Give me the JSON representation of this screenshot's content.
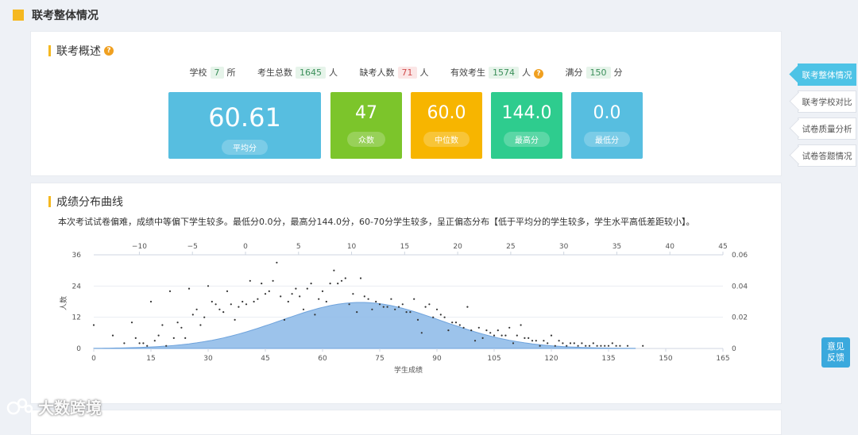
{
  "page_title": "联考整体情况",
  "overview": {
    "title": "联考概述",
    "stats": [
      {
        "label": "学校",
        "value": "7",
        "unit": "所",
        "tone": "g"
      },
      {
        "label": "考生总数",
        "value": "1645",
        "unit": "人",
        "tone": "g"
      },
      {
        "label": "缺考人数",
        "value": "71",
        "unit": "人",
        "tone": "r"
      },
      {
        "label": "有效考生",
        "value": "1574",
        "unit": "人",
        "tone": "g"
      },
      {
        "label": "满分",
        "value": "150",
        "unit": "分",
        "tone": "g"
      }
    ],
    "tiles": [
      {
        "value": "60.61",
        "label": "平均分",
        "color": "#57bee0"
      },
      {
        "value": "47",
        "label": "众数",
        "color": "#7cc52b"
      },
      {
        "value": "60.0",
        "label": "中位数",
        "color": "#f7b500"
      },
      {
        "value": "144.0",
        "label": "最高分",
        "color": "#2ecc8e"
      },
      {
        "value": "0.0",
        "label": "最低分",
        "color": "#57bee0"
      }
    ]
  },
  "distribution": {
    "title": "成绩分布曲线",
    "description": "本次考试试卷偏难，成绩中等偏下学生较多。最低分0.0分，最高分144.0分，60-70分学生较多，呈正偏态分布【低于平均分的学生较多，学生水平高低差距较小】。"
  },
  "chart_data": {
    "type": "scatter",
    "xlabel": "学生成绩",
    "ylabel": "人数",
    "xlim": [
      0,
      165
    ],
    "ylim": [
      0,
      36
    ],
    "x_ticks": [
      0,
      15,
      30,
      45,
      60,
      75,
      90,
      105,
      120,
      135,
      150,
      165
    ],
    "y_ticks": [
      0,
      12,
      24,
      36
    ],
    "top_axis": {
      "lim": [
        -14.3,
        45
      ],
      "ticks": [
        -10,
        -5,
        0,
        5,
        10,
        15,
        20,
        25,
        30,
        35,
        40,
        45
      ]
    },
    "right_axis": {
      "lim": [
        0,
        0.06
      ],
      "ticks": [
        "0",
        "0.02",
        "0.04",
        "0.06"
      ]
    },
    "curve": {
      "mean": 70,
      "sd": 21,
      "peak_density": 0.0295,
      "range": [
        0,
        142
      ],
      "color": "#8bb8e8"
    },
    "points": [
      [
        0,
        9
      ],
      [
        5,
        5
      ],
      [
        8,
        2
      ],
      [
        10,
        10
      ],
      [
        11,
        4
      ],
      [
        12,
        2
      ],
      [
        13,
        2
      ],
      [
        14,
        1
      ],
      [
        15,
        18
      ],
      [
        16,
        3
      ],
      [
        17,
        5
      ],
      [
        18,
        9
      ],
      [
        19,
        1
      ],
      [
        20,
        22
      ],
      [
        21,
        4
      ],
      [
        22,
        10
      ],
      [
        23,
        8
      ],
      [
        24,
        4
      ],
      [
        25,
        23
      ],
      [
        26,
        13
      ],
      [
        27,
        15
      ],
      [
        28,
        9
      ],
      [
        29,
        12
      ],
      [
        30,
        24
      ],
      [
        31,
        18
      ],
      [
        32,
        17
      ],
      [
        33,
        15
      ],
      [
        34,
        14
      ],
      [
        35,
        22
      ],
      [
        36,
        17
      ],
      [
        37,
        11
      ],
      [
        38,
        16
      ],
      [
        39,
        18
      ],
      [
        40,
        17
      ],
      [
        41,
        26
      ],
      [
        42,
        18
      ],
      [
        43,
        19
      ],
      [
        44,
        25
      ],
      [
        45,
        21
      ],
      [
        46,
        22
      ],
      [
        47,
        26
      ],
      [
        48,
        33
      ],
      [
        49,
        20
      ],
      [
        50,
        11
      ],
      [
        51,
        18
      ],
      [
        52,
        21
      ],
      [
        53,
        23
      ],
      [
        54,
        20
      ],
      [
        55,
        15
      ],
      [
        56,
        23
      ],
      [
        57,
        25
      ],
      [
        58,
        13
      ],
      [
        59,
        19
      ],
      [
        60,
        22
      ],
      [
        61,
        18
      ],
      [
        62,
        25
      ],
      [
        63,
        30
      ],
      [
        64,
        25
      ],
      [
        65,
        26
      ],
      [
        66,
        27
      ],
      [
        67,
        17
      ],
      [
        68,
        21
      ],
      [
        69,
        14
      ],
      [
        70,
        27
      ],
      [
        71,
        20
      ],
      [
        72,
        19
      ],
      [
        73,
        15
      ],
      [
        74,
        18
      ],
      [
        75,
        17
      ],
      [
        76,
        16
      ],
      [
        77,
        16
      ],
      [
        78,
        19
      ],
      [
        79,
        15
      ],
      [
        80,
        16
      ],
      [
        81,
        17
      ],
      [
        82,
        14
      ],
      [
        83,
        14
      ],
      [
        84,
        19
      ],
      [
        85,
        11
      ],
      [
        86,
        6
      ],
      [
        87,
        16
      ],
      [
        88,
        17
      ],
      [
        89,
        12
      ],
      [
        90,
        15
      ],
      [
        91,
        13
      ],
      [
        92,
        12
      ],
      [
        93,
        7
      ],
      [
        94,
        10
      ],
      [
        95,
        10
      ],
      [
        96,
        9
      ],
      [
        97,
        8
      ],
      [
        98,
        16
      ],
      [
        99,
        7
      ],
      [
        100,
        3
      ],
      [
        101,
        8
      ],
      [
        102,
        4
      ],
      [
        103,
        7
      ],
      [
        104,
        6
      ],
      [
        105,
        5
      ],
      [
        106,
        7
      ],
      [
        107,
        5
      ],
      [
        108,
        5
      ],
      [
        109,
        8
      ],
      [
        110,
        2
      ],
      [
        111,
        5
      ],
      [
        112,
        9
      ],
      [
        113,
        4
      ],
      [
        114,
        4
      ],
      [
        115,
        3
      ],
      [
        116,
        3
      ],
      [
        117,
        1
      ],
      [
        118,
        3
      ],
      [
        119,
        2
      ],
      [
        120,
        5
      ],
      [
        121,
        1
      ],
      [
        122,
        3
      ],
      [
        123,
        2
      ],
      [
        124,
        1
      ],
      [
        125,
        2
      ],
      [
        126,
        2
      ],
      [
        127,
        1
      ],
      [
        128,
        2
      ],
      [
        129,
        1
      ],
      [
        130,
        1
      ],
      [
        131,
        2
      ],
      [
        132,
        1
      ],
      [
        133,
        1
      ],
      [
        134,
        1
      ],
      [
        135,
        1
      ],
      [
        136,
        2
      ],
      [
        137,
        1
      ],
      [
        138,
        1
      ],
      [
        140,
        1
      ],
      [
        144,
        1
      ]
    ]
  },
  "sidenav": {
    "items": [
      "联考整体情况",
      "联考学校对比",
      "试卷质量分析",
      "试卷答题情况"
    ]
  },
  "feedback": {
    "line1": "意见",
    "line2": "反馈"
  },
  "watermark": {
    "text": "大数跨境"
  }
}
